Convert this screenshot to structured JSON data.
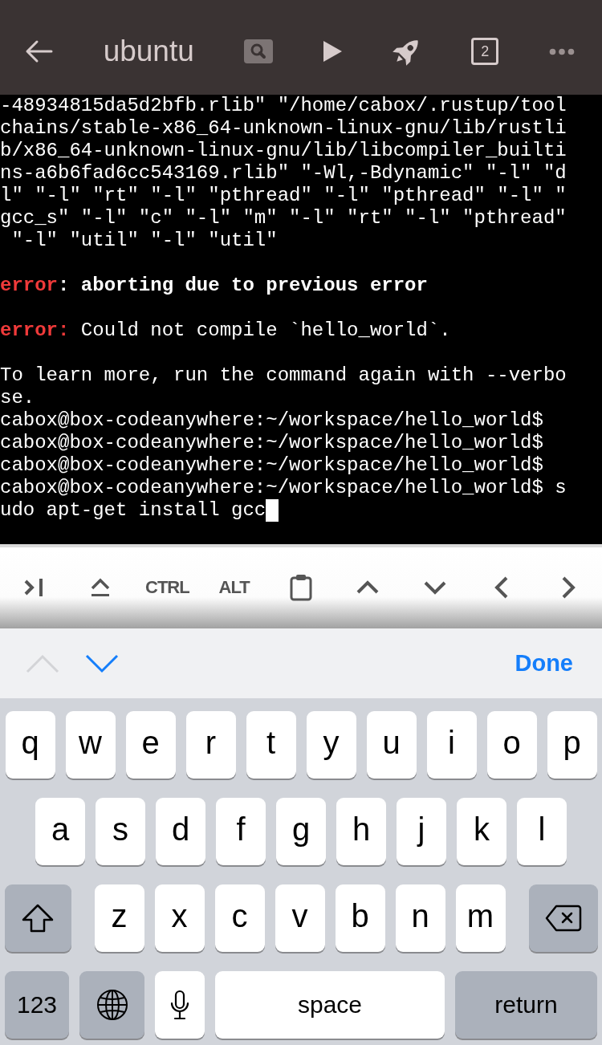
{
  "top_bar": {
    "title": "ubuntu",
    "window_count": "2"
  },
  "terminal": {
    "cursor_visible": true,
    "lines": [
      {
        "kind": "plain",
        "text": "-48934815da5d2bfb.rlib\" \"/home/cabox/.rustup/tool"
      },
      {
        "kind": "plain",
        "text": "chains/stable-x86_64-unknown-linux-gnu/lib/rustli"
      },
      {
        "kind": "plain",
        "text": "b/x86_64-unknown-linux-gnu/lib/libcompiler_builti"
      },
      {
        "kind": "plain",
        "text": "ns-a6b6fad6cc543169.rlib\" \"-Wl,-Bdynamic\" \"-l\" \"d"
      },
      {
        "kind": "plain",
        "text": "l\" \"-l\" \"rt\" \"-l\" \"pthread\" \"-l\" \"pthread\" \"-l\" \""
      },
      {
        "kind": "plain",
        "text": "gcc_s\" \"-l\" \"c\" \"-l\" \"m\" \"-l\" \"rt\" \"-l\" \"pthread\""
      },
      {
        "kind": "plain",
        "text": " \"-l\" \"util\" \"-l\" \"util\""
      },
      {
        "kind": "blank"
      },
      {
        "kind": "rich",
        "segments": [
          {
            "kind": "error",
            "text": "error"
          },
          {
            "kind": "bold",
            "text": ": aborting due to previous error"
          }
        ]
      },
      {
        "kind": "blank"
      },
      {
        "kind": "rich",
        "segments": [
          {
            "kind": "error",
            "text": "error:"
          },
          {
            "kind": "plain",
            "text": " Could not compile `hello_world`."
          }
        ]
      },
      {
        "kind": "blank"
      },
      {
        "kind": "plain",
        "text": "To learn more, run the command again with --verbo"
      },
      {
        "kind": "plain",
        "text": "se."
      },
      {
        "kind": "plain",
        "text": "cabox@box-codeanywhere:~/workspace/hello_world$"
      },
      {
        "kind": "plain",
        "text": "cabox@box-codeanywhere:~/workspace/hello_world$"
      },
      {
        "kind": "plain",
        "text": "cabox@box-codeanywhere:~/workspace/hello_world$"
      },
      {
        "kind": "plain",
        "text": "cabox@box-codeanywhere:~/workspace/hello_world$ s"
      },
      {
        "kind": "plain",
        "text": "udo apt-get install gcc"
      }
    ]
  },
  "toolbar": {
    "modifier_keys": [
      "CTRL",
      "ALT"
    ]
  },
  "accessory_bar": {
    "previous_field": {
      "disabled": true
    },
    "next_field": {
      "disabled": false
    },
    "done_label": "Done"
  },
  "keyboard": {
    "letter_rows": [
      {
        "keys": [
          {
            "kind": "letter",
            "label": "q"
          },
          {
            "kind": "letter",
            "label": "w"
          },
          {
            "kind": "letter",
            "label": "e"
          },
          {
            "kind": "letter",
            "label": "r"
          },
          {
            "kind": "letter",
            "label": "t"
          },
          {
            "kind": "letter",
            "label": "y"
          },
          {
            "kind": "letter",
            "label": "u"
          },
          {
            "kind": "letter",
            "label": "i"
          },
          {
            "kind": "letter",
            "label": "o"
          },
          {
            "kind": "letter",
            "label": "p"
          }
        ]
      },
      {
        "keys": [
          {
            "kind": "letter",
            "label": "a"
          },
          {
            "kind": "letter",
            "label": "s"
          },
          {
            "kind": "letter",
            "label": "d"
          },
          {
            "kind": "letter",
            "label": "f"
          },
          {
            "kind": "letter",
            "label": "g"
          },
          {
            "kind": "letter",
            "label": "h"
          },
          {
            "kind": "letter",
            "label": "j"
          },
          {
            "kind": "letter",
            "label": "k"
          },
          {
            "kind": "letter",
            "label": "l"
          }
        ]
      },
      {
        "keys": [
          {
            "kind": "shift"
          },
          {
            "kind": "letter",
            "label": "z"
          },
          {
            "kind": "letter",
            "label": "x"
          },
          {
            "kind": "letter",
            "label": "c"
          },
          {
            "kind": "letter",
            "label": "v"
          },
          {
            "kind": "letter",
            "label": "b"
          },
          {
            "kind": "letter",
            "label": "n"
          },
          {
            "kind": "letter",
            "label": "m"
          },
          {
            "kind": "backspace"
          }
        ]
      }
    ],
    "bottom_row": {
      "keys": [
        {
          "kind": "mode",
          "label": "123"
        },
        {
          "kind": "globe"
        },
        {
          "kind": "mic"
        },
        {
          "kind": "space",
          "label": "space"
        },
        {
          "kind": "return",
          "label": "return"
        }
      ]
    }
  }
}
